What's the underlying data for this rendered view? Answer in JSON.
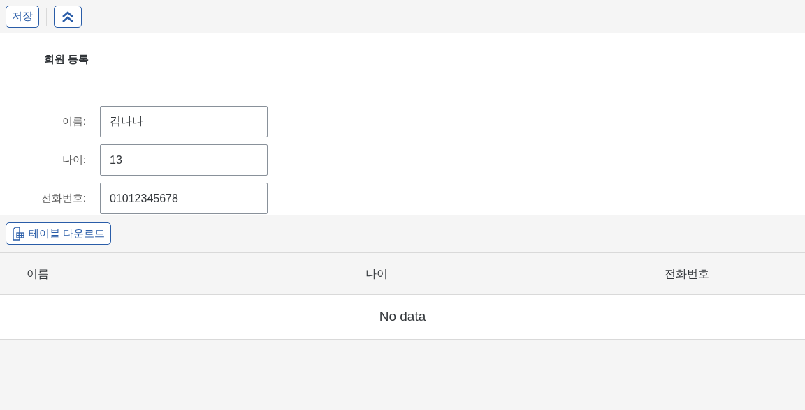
{
  "toolbar": {
    "buttons": [
      "저장"
    ]
  },
  "form": {
    "title": "회원 등록",
    "fields": [
      {
        "label": "이름:",
        "value": "김나나"
      },
      {
        "label": "나이:",
        "value": "13"
      },
      {
        "label": "전화번호:",
        "value": "01012345678"
      }
    ]
  },
  "table": {
    "download_button": "테이블 다운로드",
    "columns": [
      "이름",
      "나이",
      "전화번호"
    ],
    "empty_text": "No data"
  }
}
